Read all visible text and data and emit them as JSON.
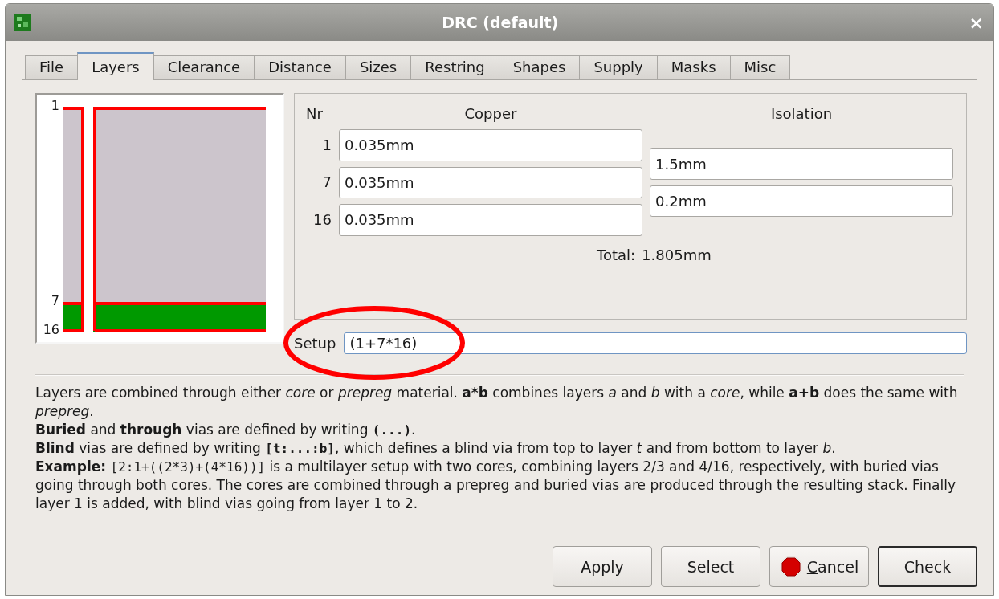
{
  "window": {
    "title": "DRC (default)",
    "close": "×"
  },
  "tabs": [
    {
      "label": "File",
      "selected": false
    },
    {
      "label": "Layers",
      "selected": true
    },
    {
      "label": "Clearance",
      "selected": false
    },
    {
      "label": "Distance",
      "selected": false
    },
    {
      "label": "Sizes",
      "selected": false
    },
    {
      "label": "Restring",
      "selected": false
    },
    {
      "label": "Shapes",
      "selected": false
    },
    {
      "label": "Supply",
      "selected": false
    },
    {
      "label": "Masks",
      "selected": false
    },
    {
      "label": "Misc",
      "selected": false
    }
  ],
  "stack": {
    "labels": [
      "1",
      "7",
      "16"
    ]
  },
  "headers": {
    "nr": "Nr",
    "copper": "Copper",
    "isolation": "Isolation"
  },
  "copper": [
    {
      "nr": "1",
      "value": "0.035mm"
    },
    {
      "nr": "7",
      "value": "0.035mm"
    },
    {
      "nr": "16",
      "value": "0.035mm"
    }
  ],
  "isolation": [
    {
      "value": "1.5mm"
    },
    {
      "value": "0.2mm"
    }
  ],
  "total": {
    "label": "Total:",
    "value": "1.805mm"
  },
  "setup": {
    "label": "Setup",
    "value": "(1+7*16)"
  },
  "help": [
    [
      {
        "text": "Layers are combined through either *core* or *prepreg* material. **a*b** combines layers *a* and *b* with a *core*, while **a+b** does the same with *prepreg*."
      }
    ],
    [
      {
        "text": "**Buried** and **through** vias are defined by writing "
      },
      {
        "text": "**(...)**",
        "mono": true
      },
      {
        "text": "."
      }
    ],
    [
      {
        "text": "**Blind** vias are defined by writing "
      },
      {
        "text": "**[t:...:b]**",
        "mono": true
      },
      {
        "text": ", which defines a blind via from top to layer *t* and from bottom to layer *b*."
      }
    ],
    [
      {
        "text": "**Example:** "
      },
      {
        "text": "[2:1+((2*3)+(4*16))]",
        "mono": true
      },
      {
        "text": " is a multilayer setup with two cores, combining layers 2/3 and 4/16, respectively, with buried vias going through both cores. The cores are combined through a prepreg and buried vias are produced through the resulting stack. Finally layer 1 is added, with blind vias going from layer 1 to 2."
      }
    ]
  ],
  "buttons": [
    {
      "label": "Apply",
      "default": false
    },
    {
      "label": "Select",
      "default": false
    },
    {
      "label": "Cancel",
      "default": false,
      "kind": "icon"
    },
    {
      "label": "Check",
      "default": true
    }
  ]
}
